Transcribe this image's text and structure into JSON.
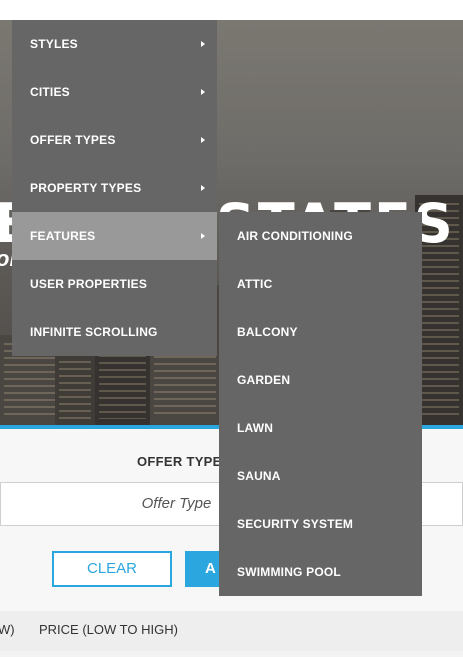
{
  "hero": {
    "title_left": "E",
    "title_right": "STATES",
    "subtitle": "ok"
  },
  "nav_menu": {
    "items": [
      {
        "label": "STYLES",
        "has_submenu": true
      },
      {
        "label": "CITIES",
        "has_submenu": true
      },
      {
        "label": "OFFER TYPES",
        "has_submenu": true
      },
      {
        "label": "PROPERTY TYPES",
        "has_submenu": true
      },
      {
        "label": "FEATURES",
        "has_submenu": true,
        "active": true
      },
      {
        "label": "USER PROPERTIES",
        "has_submenu": false
      },
      {
        "label": "INFINITE SCROLLING",
        "has_submenu": false
      }
    ]
  },
  "features_submenu": {
    "items": [
      {
        "label": "AIR CONDITIONING"
      },
      {
        "label": "ATTIC"
      },
      {
        "label": "BALCONY"
      },
      {
        "label": "GARDEN"
      },
      {
        "label": "LAWN"
      },
      {
        "label": "SAUNA"
      },
      {
        "label": "SECURITY SYSTEM"
      },
      {
        "label": "SWIMMING POOL"
      }
    ]
  },
  "search": {
    "offer_type_label": "OFFER TYPE",
    "offer_type_placeholder": "Offer Type",
    "clear_label": "CLEAR",
    "apply_label": "A"
  },
  "sort": {
    "option_left": "W)",
    "option_price_low_high": "PRICE (LOW TO HIGH)"
  },
  "colors": {
    "accent": "#2ba6de",
    "menu_bg": "#666666",
    "menu_active_bg": "#999999"
  }
}
